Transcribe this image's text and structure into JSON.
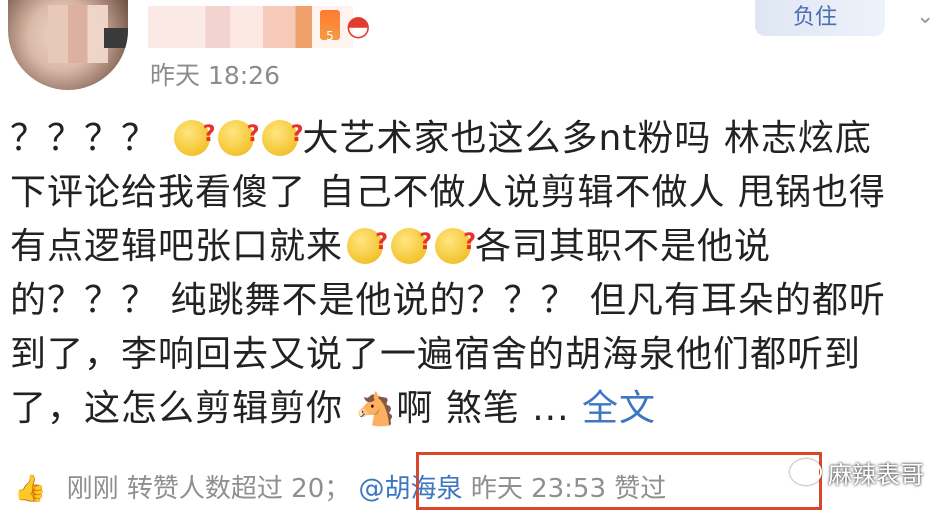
{
  "post": {
    "time": "昨天 18:26",
    "level": "5",
    "lines": [
      "？？？？",
      "大艺术家也这么多nt粉吗 林志炫底",
      "下评论给我看傻了 自己不做人说剪辑不做人 甩锅也得",
      "有点逻辑吧张口就来",
      "各司其职不是他说",
      "的？？？ 纯跳舞不是他说的？？？ 但凡有耳朵的都听",
      "到了，李响回去又说了一遍宿舍的胡海泉他们都听到",
      "了，这怎么剪辑剪你",
      "啊  煞笔 ...",
      "全文"
    ]
  },
  "footer": {
    "status": "刚刚 转赞人数超过 20；",
    "mention": "@胡海泉",
    "mention_time": "昨天 23:53 赞过"
  },
  "badge": {
    "text": "负住"
  },
  "watermark": {
    "text": "麻辣表哥"
  },
  "icons": {
    "thumb": "thumbs-up-icon",
    "melon": "watermelon-icon",
    "emoji": "confused-face-icon",
    "horse": "horse-face-icon",
    "wechat": "wechat-icon",
    "chevron": "chevron-down-icon"
  },
  "colors": {
    "link": "#3d77c1",
    "highlight_border": "#d9472b",
    "muted": "#8f8f8f"
  }
}
